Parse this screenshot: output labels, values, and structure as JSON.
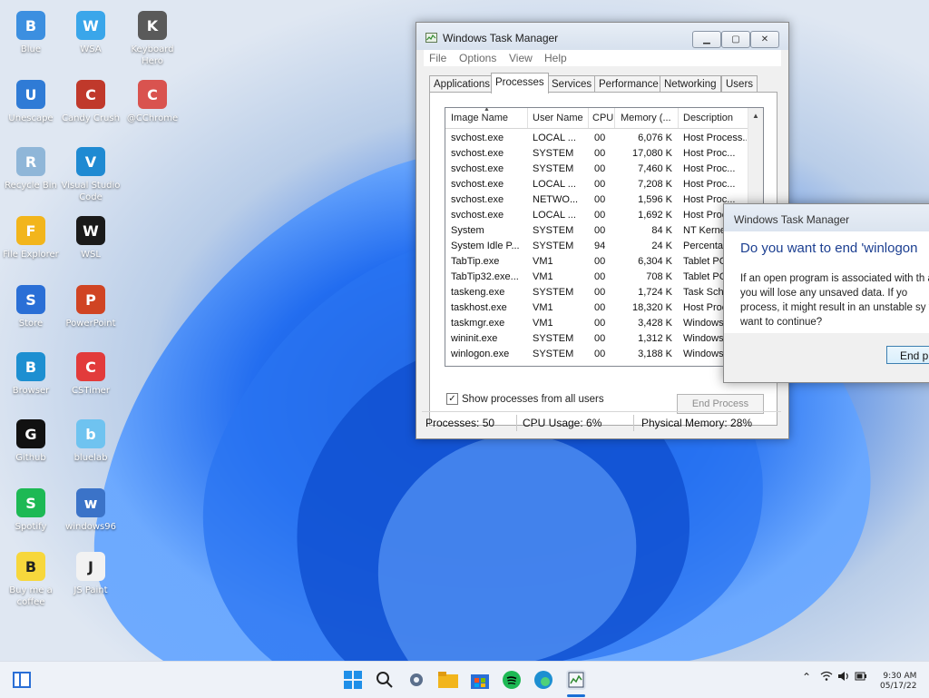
{
  "desktop": {
    "icons": [
      {
        "label": "Blue",
        "icon": "blue-app-icon",
        "color": "#3c8fe0"
      },
      {
        "label": "WSA",
        "icon": "wsa-icon",
        "color": "#3aa6ea"
      },
      {
        "label": "Keyboard Hero",
        "icon": "keyboard-icon",
        "color": "#5a5a5a"
      },
      {
        "label": "Unescape",
        "icon": "unescape-icon",
        "color": "#2f7bd6"
      },
      {
        "label": "Candy Crush",
        "icon": "candy-crush-icon",
        "color": "#c0392b"
      },
      {
        "label": "@CChrome",
        "icon": "chrome-icon",
        "color": "#d9534f"
      },
      {
        "label": "Recycle Bin",
        "icon": "recycle-bin-icon",
        "color": "#8fb6d8"
      },
      {
        "label": "Visual Studio Code",
        "icon": "vscode-icon",
        "color": "#1f8ad2"
      },
      {
        "label": "File Explorer",
        "icon": "folder-icon",
        "color": "#f2b51c"
      },
      {
        "label": "WSL",
        "icon": "penguin-icon",
        "color": "#1a1a1a"
      },
      {
        "label": "Store",
        "icon": "store-icon",
        "color": "#2a6fd6"
      },
      {
        "label": "PowerPoint",
        "icon": "powerpoint-icon",
        "color": "#d04423"
      },
      {
        "label": "Browser",
        "icon": "edge-icon",
        "color": "#1d8fd1"
      },
      {
        "label": "CSTimer",
        "icon": "cstimer-icon",
        "color": "#e23b3b"
      },
      {
        "label": "Github",
        "icon": "github-icon",
        "color": "#111111"
      },
      {
        "label": "bluelab",
        "icon": "bluelab-icon",
        "color": "#6fc3f0"
      },
      {
        "label": "Spotify",
        "icon": "spotify-icon",
        "color": "#1db954"
      },
      {
        "label": "windows96",
        "icon": "windows96-icon",
        "color": "#3b73c8"
      },
      {
        "label": "Buy me a coffee",
        "icon": "coffee-icon",
        "color": "#f7d73c"
      },
      {
        "label": "JS Paint",
        "icon": "paint-icon",
        "color": "#f2f2f2"
      }
    ]
  },
  "task_manager": {
    "title": "Windows Task Manager",
    "menu": [
      "File",
      "Options",
      "View",
      "Help"
    ],
    "tabs": [
      "Applications",
      "Processes",
      "Services",
      "Performance",
      "Networking",
      "Users"
    ],
    "active_tab": "Processes",
    "columns": [
      "Image Name",
      "User Name",
      "CPU",
      "Memory (...",
      "Description"
    ],
    "rows": [
      [
        "svchost.exe",
        "LOCAL ...",
        "00",
        "6,076 K",
        "Host Process..."
      ],
      [
        "svchost.exe",
        "SYSTEM",
        "00",
        "17,080 K",
        "Host Proc..."
      ],
      [
        "svchost.exe",
        "SYSTEM",
        "00",
        "7,460 K",
        "Host Proc..."
      ],
      [
        "svchost.exe",
        "LOCAL ...",
        "00",
        "7,208 K",
        "Host Proc..."
      ],
      [
        "svchost.exe",
        "NETWO...",
        "00",
        "1,596 K",
        "Host Proc..."
      ],
      [
        "svchost.exe",
        "LOCAL ...",
        "00",
        "1,692 K",
        "Host Proc"
      ],
      [
        "System",
        "SYSTEM",
        "00",
        "84 K",
        "NT Kerne"
      ],
      [
        "System Idle P...",
        "SYSTEM",
        "94",
        "24 K",
        "Percenta"
      ],
      [
        "TabTip.exe",
        "VM1",
        "00",
        "6,304 K",
        "Tablet PC"
      ],
      [
        "TabTip32.exe...",
        "VM1",
        "00",
        "708 K",
        "Tablet PC"
      ],
      [
        "taskeng.exe",
        "SYSTEM",
        "00",
        "1,724 K",
        "Task Sche"
      ],
      [
        "taskhost.exe",
        "VM1",
        "00",
        "18,320 K",
        "Host Proc"
      ],
      [
        "taskmgr.exe",
        "VM1",
        "00",
        "3,428 K",
        "Windows"
      ],
      [
        "wininit.exe",
        "SYSTEM",
        "00",
        "1,312 K",
        "Windows"
      ],
      [
        "winlogon.exe",
        "SYSTEM",
        "00",
        "3,188 K",
        "Windows"
      ]
    ],
    "show_all_label": "Show processes from all users",
    "show_all_checked": true,
    "end_process_label": "End Process",
    "status": {
      "processes": "Processes: 50",
      "cpu": "CPU Usage: 6%",
      "memory": "Physical Memory: 28%"
    }
  },
  "dialog": {
    "title": "Windows Task Manager",
    "question": "Do you want to end 'winlogon",
    "message": "If an open program is associated with th and you will lose any unsaved data. If yo process, it might result in an unstable sy you want to continue?",
    "button_label": "End pr"
  },
  "taskbar": {
    "icons": [
      "start-icon",
      "search-icon",
      "settings-icon",
      "file-explorer-icon",
      "store-icon",
      "spotify-icon",
      "edge-icon",
      "task-manager-icon"
    ],
    "clock_time": "9:30 AM",
    "clock_date": "05/17/22"
  },
  "colors": {
    "accent": "#1c3f91",
    "wallpaper_blue": "#1e63e6"
  }
}
